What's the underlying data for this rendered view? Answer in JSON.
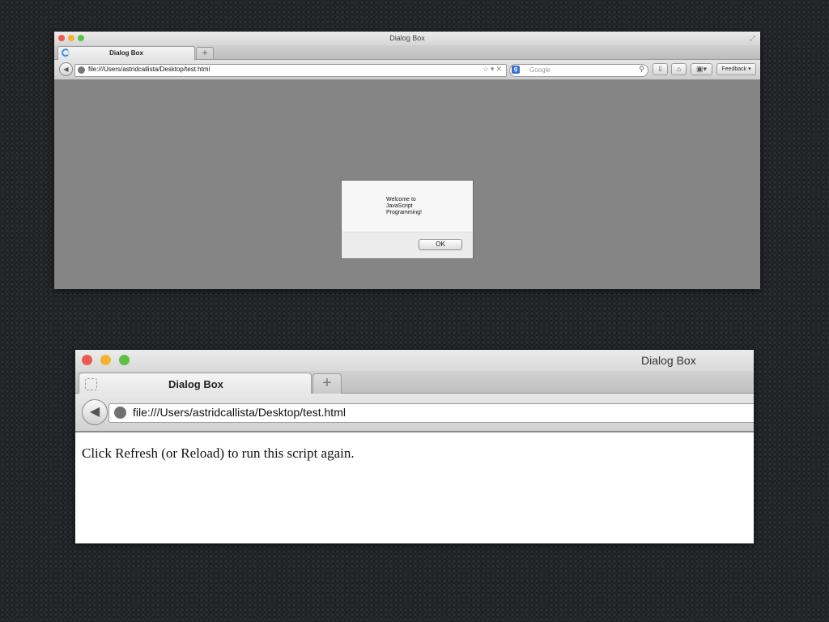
{
  "colors": {
    "traffic_close": "#ee5a52",
    "traffic_minimize": "#f3b232",
    "traffic_zoom": "#5fc044",
    "dialog_backdrop": "#858585"
  },
  "window_top": {
    "title": "Dialog Box",
    "tab": {
      "label": "Dialog Box",
      "icon": "loading-icon"
    },
    "new_tab_label": "+",
    "address": "file:///Users/astridcallista/Desktop/test.html",
    "search": {
      "engine_badge": "g",
      "placeholder": "Google"
    },
    "toolbar": {
      "feedback_label": "Feedback"
    },
    "alert": {
      "message": "Welcome to JavaScript Programming!",
      "ok_label": "OK"
    }
  },
  "window_bottom": {
    "title": "Dialog Box",
    "tab": {
      "label": "Dialog Box",
      "icon": "blank-page-icon"
    },
    "new_tab_label": "+",
    "address": "file:///Users/astridcallista/Desktop/test.html",
    "page_text": "Click Refresh (or Reload) to run this script again."
  }
}
